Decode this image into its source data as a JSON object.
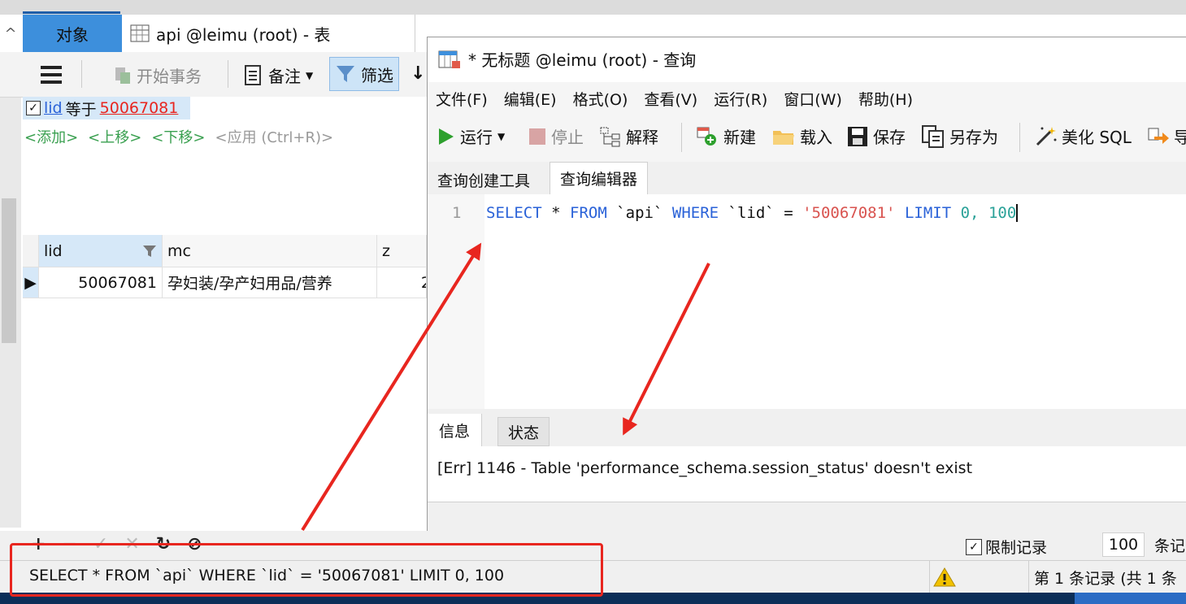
{
  "object_tab": {
    "label": "对象"
  },
  "table_tab": {
    "label": "api @leimu (root) - 表"
  },
  "left_toolbar": {
    "begin_transaction": "开始事务",
    "note": "备注",
    "filter": "筛选"
  },
  "filter": {
    "field": "lid",
    "operator": "等于",
    "value": "50067081",
    "actions": [
      "<添加>",
      "<上移>",
      "<下移>",
      "<应用 (Ctrl+R)>"
    ]
  },
  "grid": {
    "columns": [
      "lid",
      "mc",
      "z"
    ],
    "rows": [
      [
        "50067081",
        "孕妇装/孕产妇用品/营养",
        "2"
      ]
    ]
  },
  "query_window": {
    "title": "* 无标题 @leimu (root) - 查询",
    "menu": [
      "文件(F)",
      "编辑(E)",
      "格式(O)",
      "查看(V)",
      "运行(R)",
      "窗口(W)",
      "帮助(H)"
    ],
    "toolbar": {
      "run": "运行",
      "stop": "停止",
      "explain": "解释",
      "new": "新建",
      "load": "载入",
      "save": "保存",
      "save_as": "另存为",
      "beautify": "美化 SQL",
      "export": "导"
    },
    "tabs": [
      "查询创建工具",
      "查询编辑器"
    ],
    "editor": {
      "line_number": "1",
      "tokens": {
        "select": "SELECT",
        "star": "*",
        "from": "FROM",
        "table": "`api`",
        "where": "WHERE",
        "col": "`lid`",
        "eq": "=",
        "value": "'50067081'",
        "limit": "LIMIT",
        "offset": "0,",
        "count": "100"
      }
    },
    "result_tabs": [
      "信息",
      "状态"
    ],
    "message": "[Err] 1146 - Table 'performance_schema.session_status' doesn't exist"
  },
  "bottom": {
    "limit_label": "限制记录",
    "limit_value": "100",
    "limit_unit": "条记"
  },
  "status": {
    "sql": "SELECT * FROM `api` WHERE `lid` = '50067081' LIMIT 0, 100",
    "records": "第 1 条记录 (共 1 条"
  },
  "colors": {
    "accent_blue": "#1e5ea8",
    "object_tab_bg": "#3d8fdc",
    "keyword": "#2a62d8",
    "string": "#d9534f",
    "number": "#2aa198",
    "annotation_red": "#e8261f"
  }
}
